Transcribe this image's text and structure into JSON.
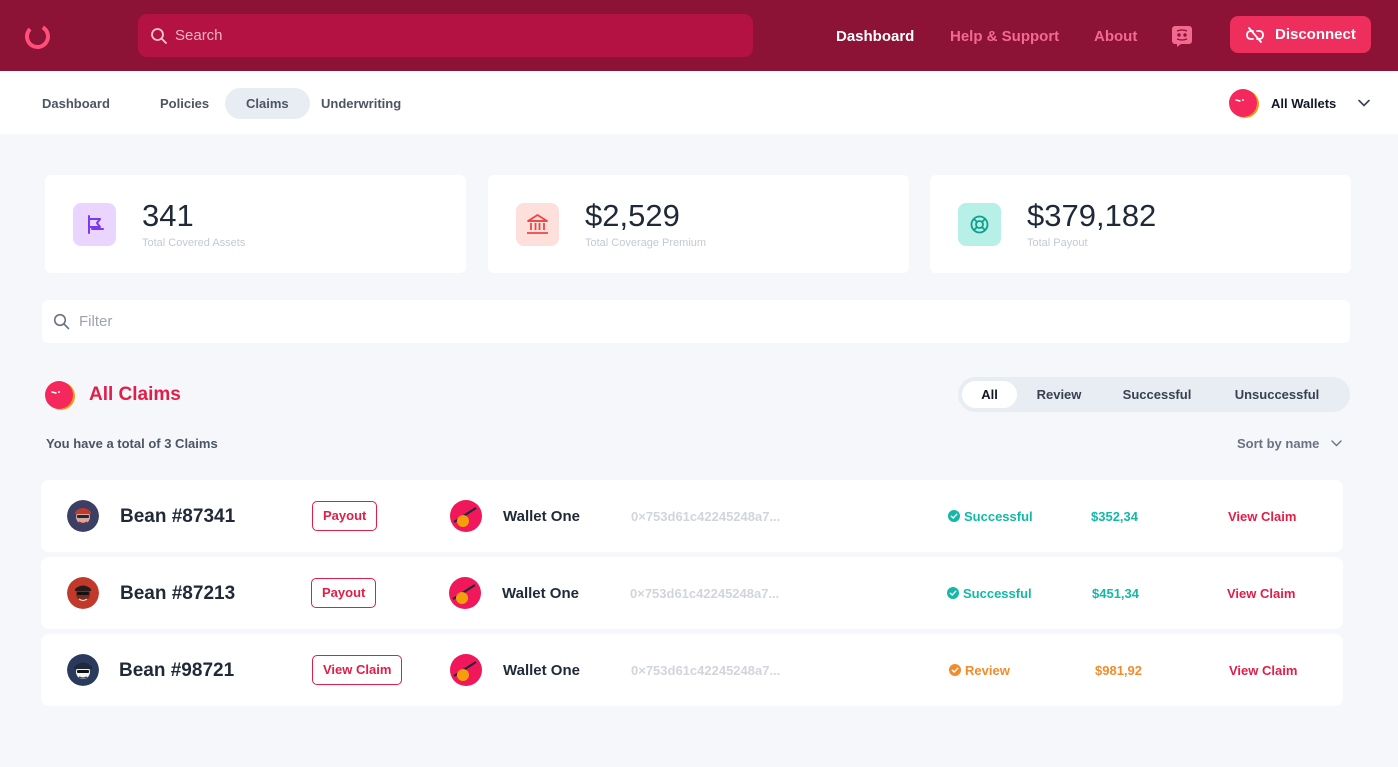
{
  "header": {
    "search_placeholder": "Search",
    "nav": [
      "Dashboard",
      "Help & Support",
      "About"
    ],
    "disconnect_label": "Disconnect"
  },
  "subnav": {
    "tabs": [
      "Dashboard",
      "Policies",
      "Claims",
      "Underwriting"
    ],
    "active_tab": "Claims",
    "wallet_selector": "All Wallets"
  },
  "stats": [
    {
      "value": "341",
      "label": "Total Covered Assets",
      "icon": "flag-icon",
      "color": "#e9d5ff"
    },
    {
      "value": "$2,529",
      "label": "Total Coverage Premium",
      "icon": "bank-icon",
      "color": "#fde0dc"
    },
    {
      "value": "$379,182",
      "label": "Total Payout",
      "icon": "lifebuoy-icon",
      "color": "#b7f0e6"
    }
  ],
  "filter": {
    "placeholder": "Filter"
  },
  "claims": {
    "title": "All Claims",
    "subtitle": "You have a total of 3 Claims",
    "segments": [
      "All",
      "Review",
      "Successful",
      "Unsuccessful"
    ],
    "active_segment": "All",
    "sort_label": "Sort by name",
    "rows": [
      {
        "name": "Bean #87341",
        "action": "Payout",
        "wallet": "Wallet One",
        "address": "0×753d61c42245248a7...",
        "status": "Successful",
        "amount": "$352,34",
        "view": "View Claim"
      },
      {
        "name": "Bean #87213",
        "action": "Payout",
        "wallet": "Wallet One",
        "address": "0×753d61c42245248a7...",
        "status": "Successful",
        "amount": "$451,34",
        "view": "View Claim"
      },
      {
        "name": "Bean #98721",
        "action": "View Claim",
        "wallet": "Wallet One",
        "address": "0×753d61c42245248a7...",
        "status": "Review",
        "amount": "$981,92",
        "view": "View Claim"
      }
    ]
  },
  "colors": {
    "header_bg": "#8c1236",
    "accent": "#e11d48",
    "success": "#14b8a6",
    "review": "#f08c2c"
  }
}
